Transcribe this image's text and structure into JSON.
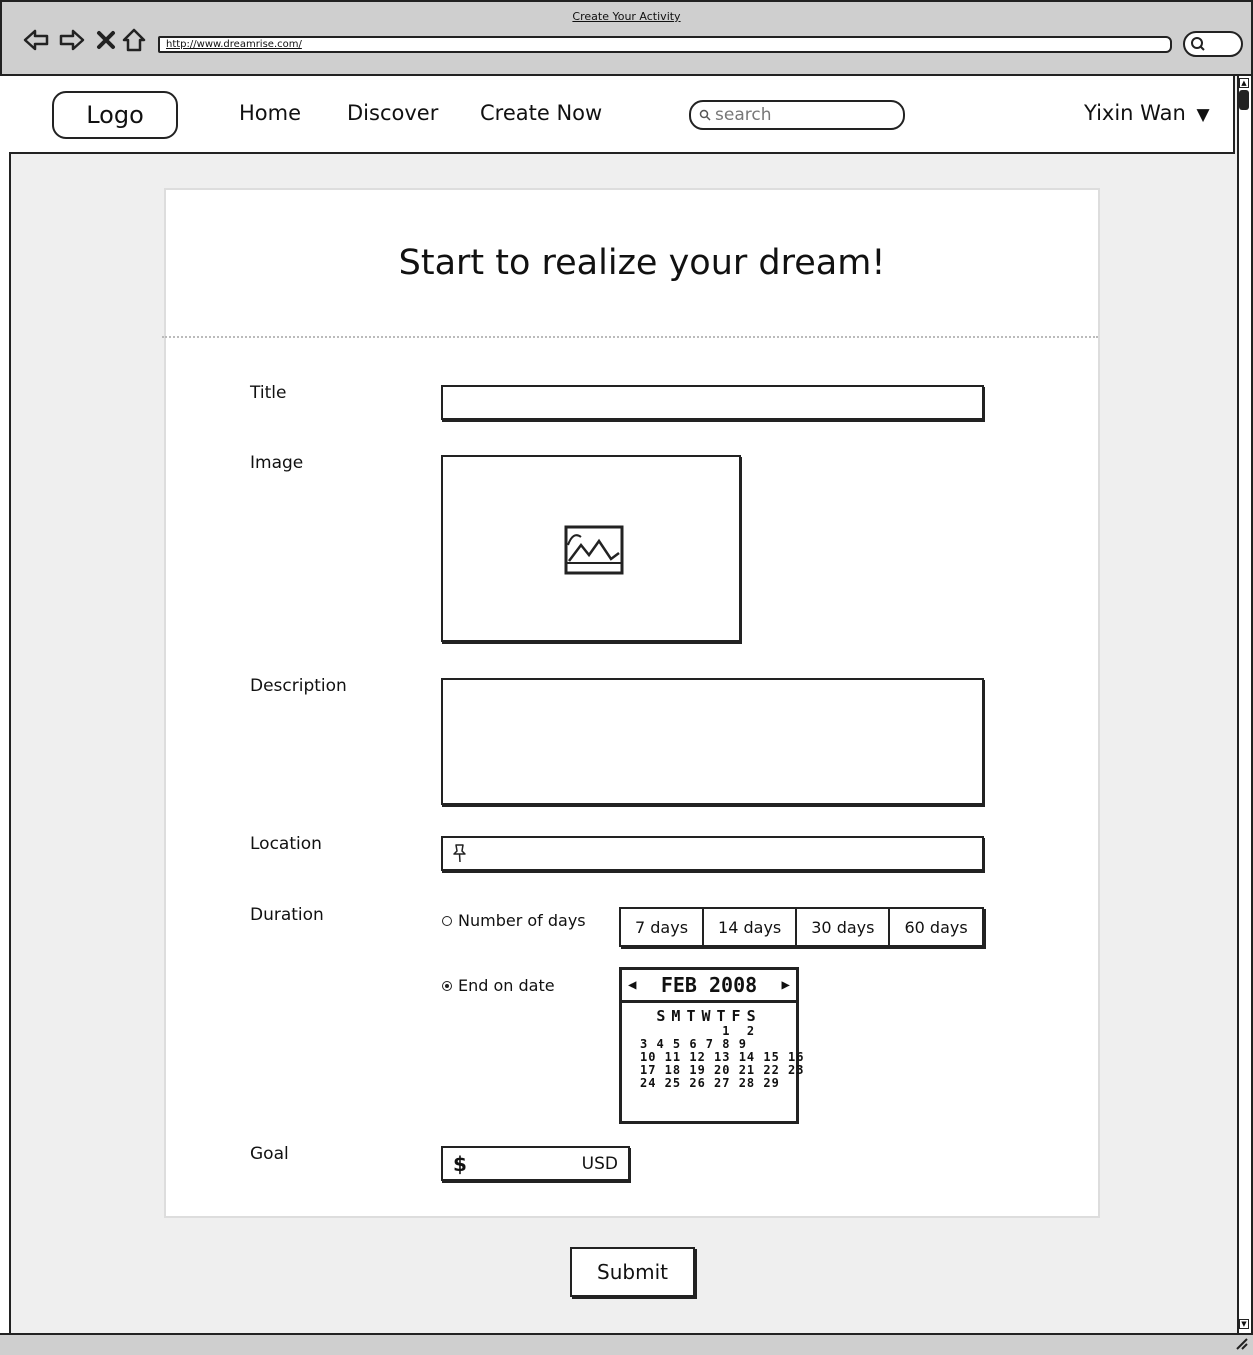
{
  "window": {
    "title": "Create Your Activity",
    "url": "http://www.dreamrise.com/"
  },
  "nav": {
    "logo": "Logo",
    "links": [
      "Home",
      "Discover",
      "Create Now"
    ],
    "search_placeholder": "search",
    "user": "Yixin Wan",
    "user_caret": "▼"
  },
  "form": {
    "heading": "Start to realize your dream!",
    "title_label": "Title",
    "image_label": "Image",
    "description_label": "Description",
    "location_label": "Location",
    "duration_label": "Duration",
    "goal_label": "Goal",
    "duration_options": {
      "number_of_days": "Number of days",
      "end_on_date": "End on date",
      "selected": "end_on_date"
    },
    "day_choices": [
      "7 days",
      "14 days",
      "30 days",
      "60 days"
    ],
    "calendar": {
      "month": "FEB 2008",
      "weekdays": "SMTWTFS",
      "rows": [
        "          1  2",
        "3 4 5 6 7 8 9",
        "10 11 12 13 14 15 16",
        "17 18 19 20 21 22 23",
        "24 25 26 27 28 29"
      ]
    },
    "goal_currency_symbol": "$",
    "goal_currency": "USD",
    "submit": "Submit"
  }
}
